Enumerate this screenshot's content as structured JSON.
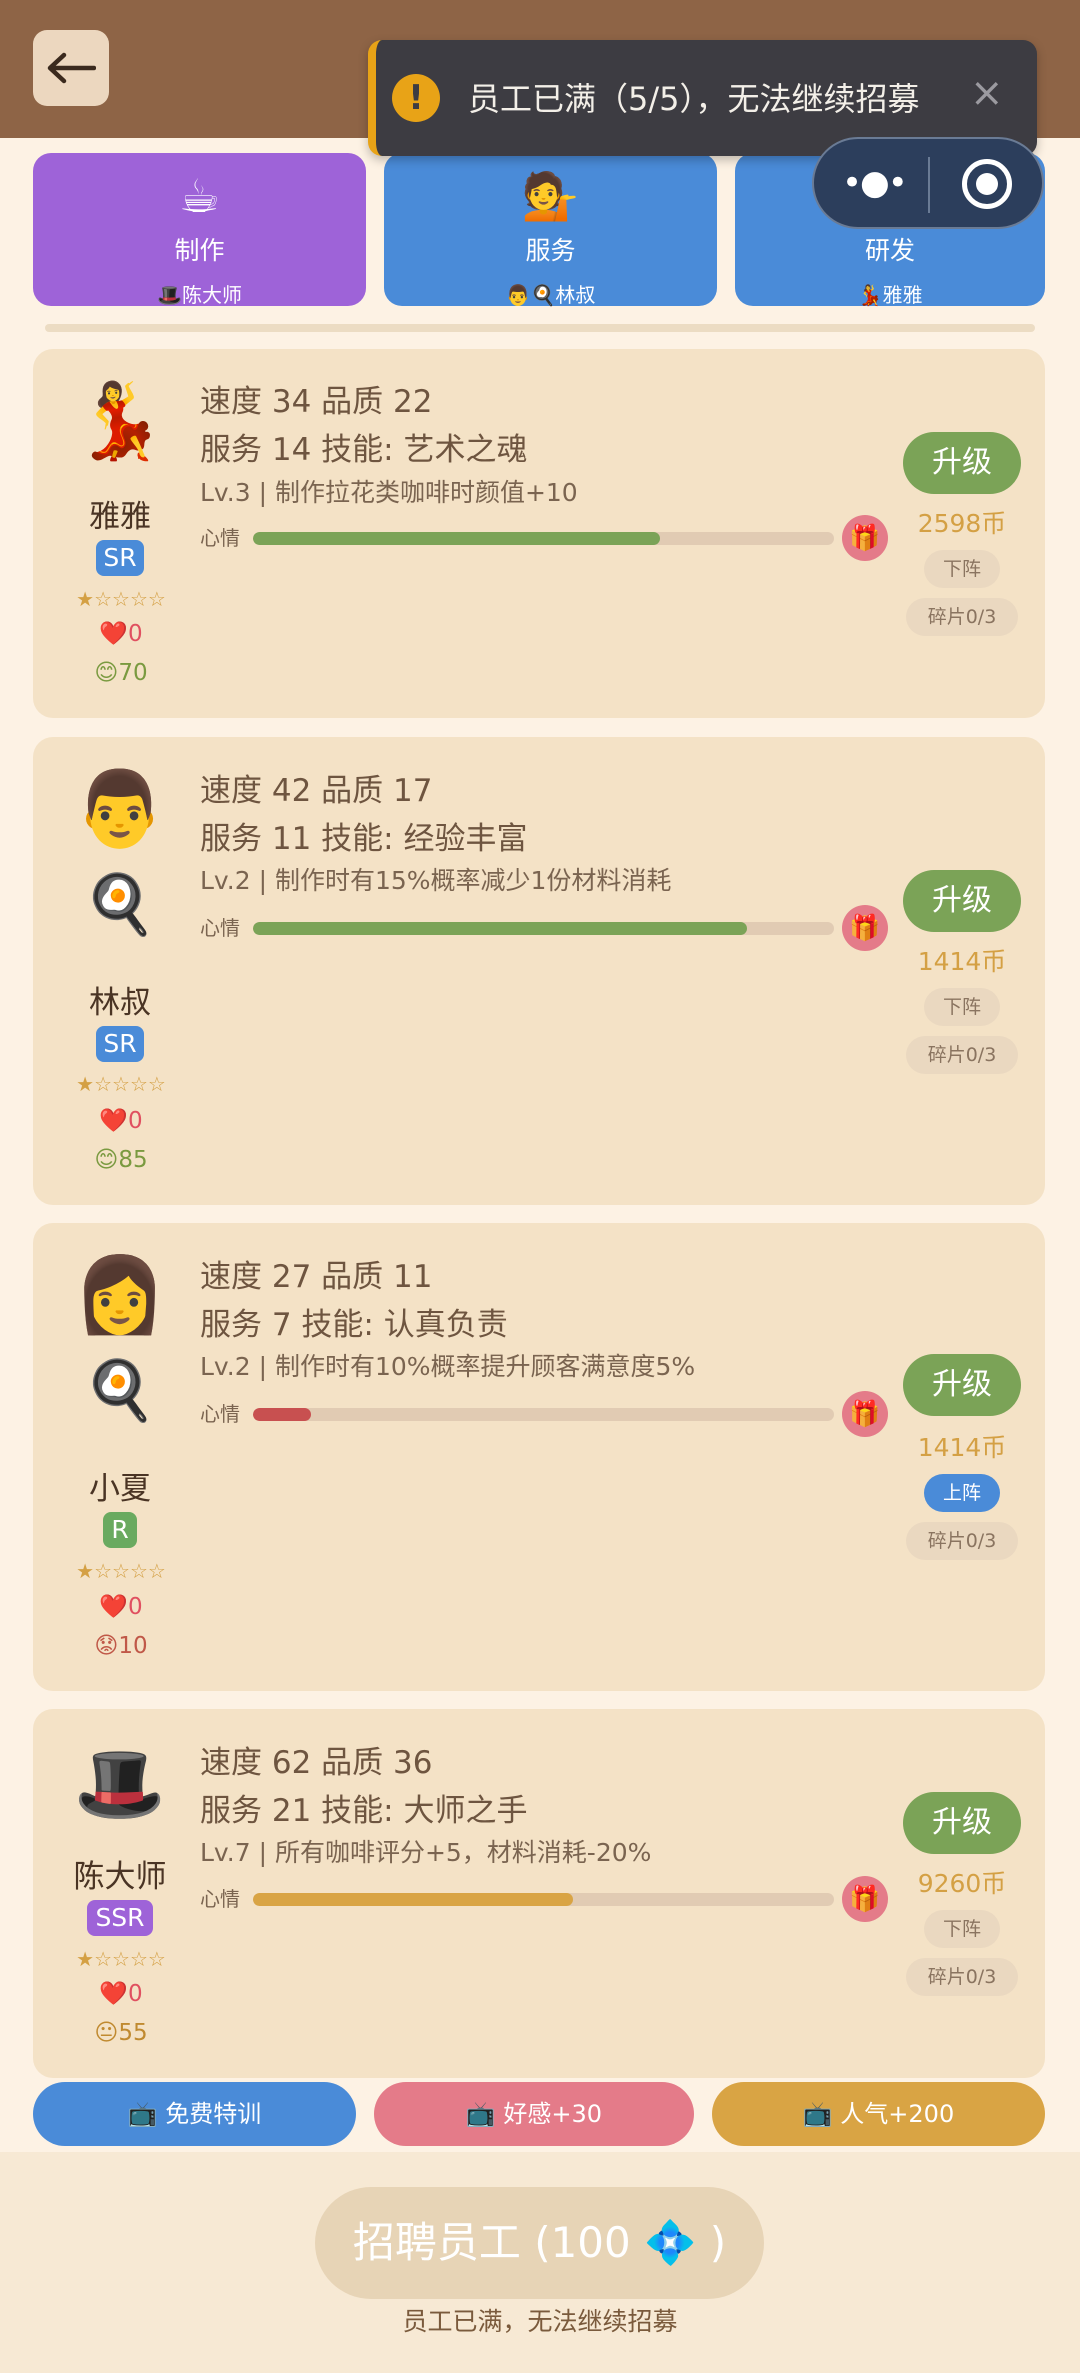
{
  "toast": {
    "icon": "!",
    "message": "员工已满（5/5），无法继续招募",
    "close": "×"
  },
  "capsule": {
    "menu": "•●•",
    "icon": "target-icon"
  },
  "tabs": [
    {
      "icon": "☕",
      "label": "制作",
      "assigned": "🎩陈大师",
      "color": "#9e63d8"
    },
    {
      "icon": "💁",
      "label": "服务",
      "assigned": "👨🍳林叔",
      "color": "#4a8bd8"
    },
    {
      "icon": "🔬",
      "label": "研发",
      "assigned": "💃雅雅",
      "color": "#4a8bd8"
    }
  ],
  "mood_label": "心情",
  "upgrade_label": "升级",
  "staff": [
    {
      "avatar": "💃",
      "role_icon": "",
      "name": "雅雅",
      "rarity": "SR",
      "rarity_color": "#4a8bd8",
      "stars": "★☆☆☆☆",
      "hearts": "❤️0",
      "mood": "😊70",
      "mood_value": 70,
      "mood_color": "#7ba357",
      "stats_line1": "速度 34  品质 22",
      "stats_line2": "服务 14  技能: 艺术之魂",
      "skill": "Lv.3 | 制作拉花类咖啡时颜值+10",
      "cost": "2598币",
      "status": "下阵",
      "fragments": "碎片0/3"
    },
    {
      "avatar": "👨",
      "role_icon": "🍳",
      "name": "林叔",
      "rarity": "SR",
      "rarity_color": "#4a8bd8",
      "stars": "★☆☆☆☆",
      "hearts": "❤️0",
      "mood": "😊85",
      "mood_value": 85,
      "mood_color": "#7ba357",
      "stats_line1": "速度 42  品质 17",
      "stats_line2": "服务 11  技能: 经验丰富",
      "skill": "Lv.2 | 制作时有15%概率减少1份材料消耗",
      "cost": "1414币",
      "status": "下阵",
      "fragments": "碎片0/3"
    },
    {
      "avatar": "👩",
      "role_icon": "🍳",
      "name": "小夏",
      "rarity": "R",
      "rarity_color": "#6aaa60",
      "stars": "★☆☆☆☆",
      "hearts": "❤️0",
      "mood": "😟10",
      "mood_value": 10,
      "mood_color": "#c85050",
      "stats_line1": "速度 27  品质 11",
      "stats_line2": "服务 7  技能: 认真负责",
      "skill": "Lv.2 | 制作时有10%概率提升顾客满意度5%",
      "cost": "1414币",
      "status": "上阵",
      "fragments": "碎片0/3"
    },
    {
      "avatar": "🎩",
      "role_icon": "",
      "name": "陈大师",
      "rarity": "SSR",
      "rarity_color": "#9e63d8",
      "stars": "★☆☆☆☆",
      "hearts": "❤️0",
      "mood": "😐55",
      "mood_value": 55,
      "mood_color": "#d9a444",
      "stats_line1": "速度 62  品质 36",
      "stats_line2": "服务 21  技能: 大师之手",
      "skill": "Lv.7 | 所有咖啡评分+5，材料消耗-20%",
      "cost": "9260币",
      "status": "下阵",
      "fragments": "碎片0/3"
    }
  ],
  "actions": [
    {
      "label": "📺 免费特训",
      "color": "#4a8bd8"
    },
    {
      "label": "📺 好感+30",
      "color": "#e47b89"
    },
    {
      "label": "📺 人气+200",
      "color": "#d9a444"
    }
  ],
  "recruit": {
    "label": "招聘员工 (100 💠 )",
    "hint": "员工已满，无法继续招募"
  }
}
